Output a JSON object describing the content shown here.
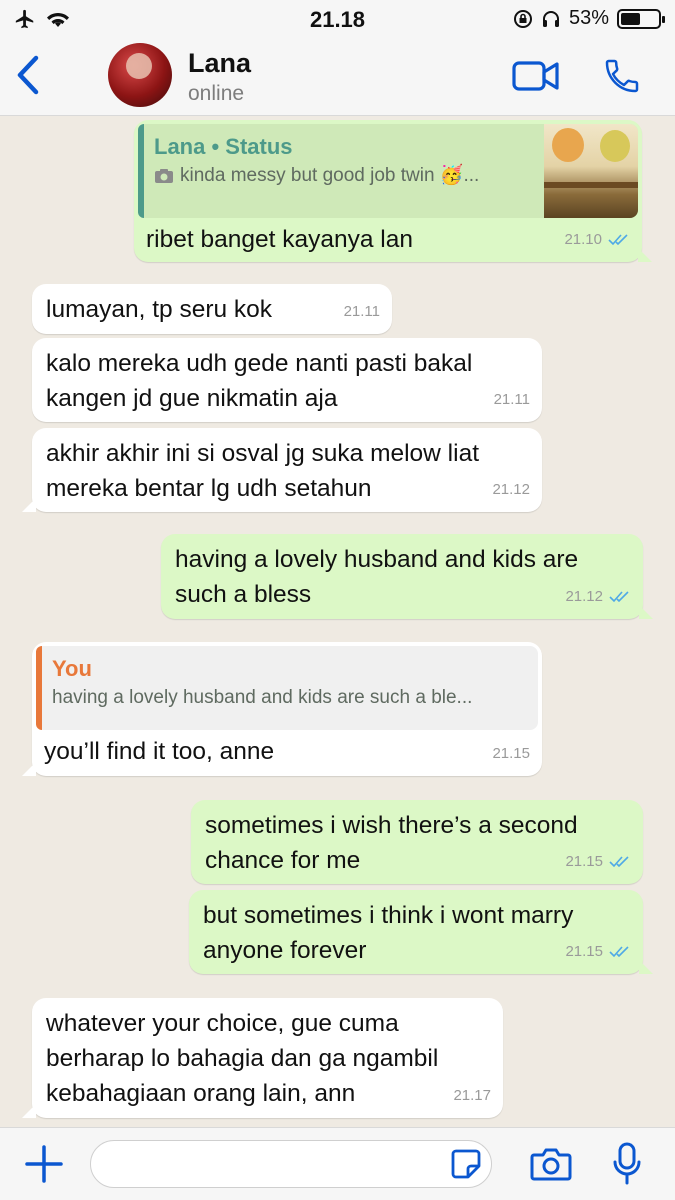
{
  "status_bar": {
    "time": "21.18",
    "battery": "53%",
    "battery_level": 0.53
  },
  "header": {
    "contact_name": "Lana",
    "contact_status": "online"
  },
  "messages": [
    {
      "direction": "out",
      "quote_title": "Lana • Status",
      "quote_text": "kinda messy but good job twin 🥳...",
      "text": "ribet banget kayanya lan",
      "time": "21.10"
    },
    {
      "direction": "in",
      "text": "lumayan, tp seru kok",
      "time": "21.11"
    },
    {
      "direction": "in",
      "text": "kalo mereka udh gede nanti pasti bakal kangen jd gue nikmatin aja",
      "line1": "kalo mereka udh gede nanti pasti bakal",
      "line2": "kangen jd gue nikmatin aja",
      "time": "21.11"
    },
    {
      "direction": "in",
      "line1": "akhir akhir ini si osval jg suka melow liat",
      "line2": "mereka bentar lg udh setahun",
      "time": "21.12"
    },
    {
      "direction": "out",
      "line1": "having a lovely husband and kids are",
      "line2": "such a bless",
      "time": "21.12"
    },
    {
      "direction": "in",
      "quote_title": "You",
      "quote_text": "having a lovely husband and kids are such a ble...",
      "text": "you’ll find it too, anne",
      "time": "21.15"
    },
    {
      "direction": "out",
      "line1": "sometimes i wish there’s a second",
      "line2": "chance for me",
      "time": "21.15"
    },
    {
      "direction": "out",
      "line1": "but sometimes i think i wont marry",
      "line2": "anyone forever",
      "time": "21.15"
    },
    {
      "direction": "in",
      "line1": "whatever your choice, gue cuma",
      "line2": "berharap lo bahagia dan ga ngambil",
      "line3": "kebahagiaan orang lain, ann",
      "time": "21.17"
    }
  ],
  "composer": {
    "placeholder": ""
  },
  "colors": {
    "accent": "#0b57d0",
    "outgoing_bubble": "#dcf8c6",
    "incoming_bubble": "#ffffff",
    "read_ticks": "#4fa9e6"
  },
  "icons": [
    "airplane-icon",
    "wifi-icon",
    "lock-rotation-icon",
    "headphones-icon",
    "battery-icon",
    "back-chevron-icon",
    "video-call-icon",
    "phone-icon",
    "camera-icon",
    "plus-icon",
    "sticker-icon",
    "microphone-icon",
    "read-ticks-icon"
  ]
}
